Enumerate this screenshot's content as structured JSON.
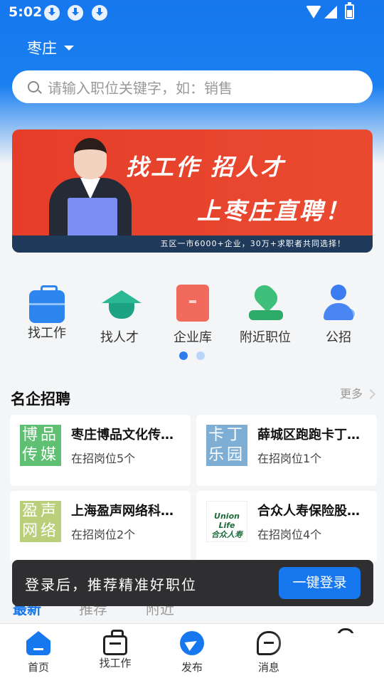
{
  "status_bar": {
    "time": "5:02"
  },
  "header": {
    "city": "枣庄",
    "search_placeholder": "请输入职位关键字，如：销售"
  },
  "banner": {
    "line1": "找工作  招人才",
    "line2": "上枣庄直聘！",
    "footer": "五区一市6000+企业，30万+求职者共同选择！"
  },
  "categories": [
    {
      "label": "找工作",
      "icon": "briefcase-icon"
    },
    {
      "label": "找人才",
      "icon": "graduation-cap-icon"
    },
    {
      "label": "企业库",
      "icon": "company-library-icon"
    },
    {
      "label": "附近职位",
      "icon": "location-pin-icon"
    },
    {
      "label": "公招",
      "icon": "public-recruit-icon"
    }
  ],
  "section": {
    "title": "名企招聘",
    "more": "更多"
  },
  "companies": [
    {
      "logo_text": "博品传媒",
      "logo_color": "#5fbf72",
      "name": "枣庄博品文化传媒有限公司",
      "positions": "在招岗位5个"
    },
    {
      "logo_text": "卡丁乐园",
      "logo_color": "#7eaed3",
      "name": "薛城区跑跑卡丁车乐园",
      "positions": "在招岗位1个"
    },
    {
      "logo_text": "盈声网络",
      "logo_color": "#b9cf7a",
      "name": "上海盈声网络科技有限公司",
      "positions": "在招岗位2个"
    },
    {
      "logo_text": "Union Life 合众人寿",
      "logo_color": "#ffffff",
      "name": "合众人寿保险股份有限公司",
      "positions": "在招岗位4个"
    }
  ],
  "tabs": [
    "最新",
    "推荐",
    "附近"
  ],
  "toast": {
    "text": "登录后，推荐精准好职位",
    "button": "一键登录"
  },
  "nav": [
    "首页",
    "找工作",
    "发布",
    "消息",
    ""
  ]
}
